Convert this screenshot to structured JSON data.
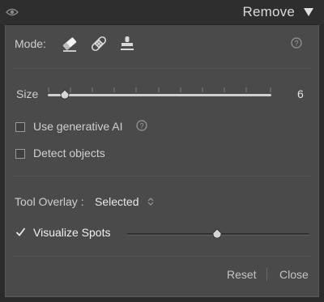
{
  "header": {
    "title": "Remove",
    "visibility_icon": "eye-icon",
    "collapse_icon": "triangle-down-icon"
  },
  "mode": {
    "label": "Mode:",
    "tools": [
      {
        "name": "eraser-icon",
        "selected": true
      },
      {
        "name": "bandage-icon",
        "selected": false
      },
      {
        "name": "stamp-icon",
        "selected": false
      }
    ],
    "help_icon": "help-circle-icon"
  },
  "size": {
    "label": "Size",
    "value": "6",
    "slider_fraction": 0.08
  },
  "generative_ai": {
    "label": "Use generative AI",
    "checked": false,
    "help_icon": "help-circle-icon"
  },
  "detect_objects": {
    "label": "Detect objects",
    "checked": false
  },
  "tool_overlay": {
    "label": "Tool Overlay :",
    "value": "Selected"
  },
  "visualize_spots": {
    "label": "Visualize Spots",
    "checked": true,
    "slider_fraction": 0.5
  },
  "footer": {
    "reset_label": "Reset",
    "close_label": "Close"
  },
  "colors": {
    "panel_bg": "#4a4a4a",
    "text": "#cfcfcf",
    "header_bg": "#2e2e2e"
  }
}
